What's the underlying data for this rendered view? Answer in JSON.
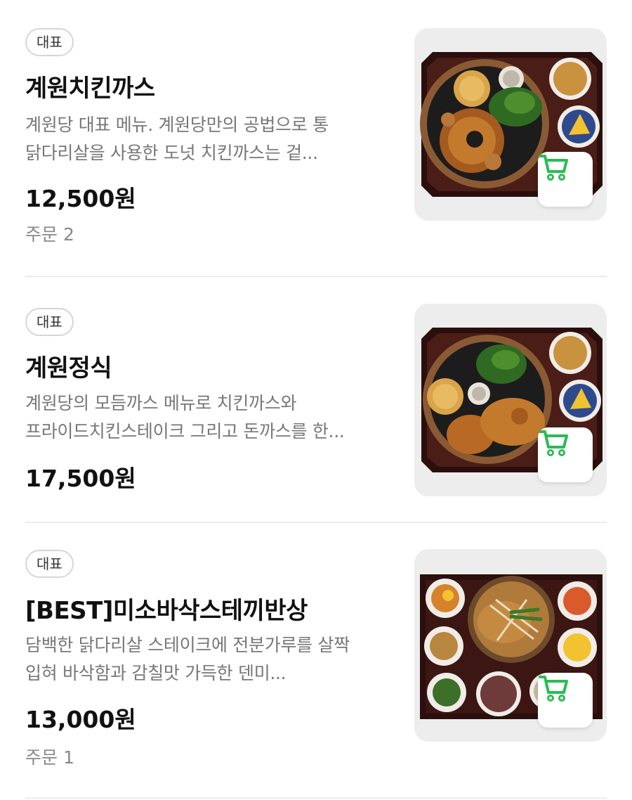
{
  "colors": {
    "cart_icon": "#2dbb54",
    "badge_border": "#d6d6d6",
    "desc_text": "#777777",
    "divider": "#ececec"
  },
  "items": [
    {
      "badge": "대표",
      "title": "계원치킨까스",
      "description": "계원당 대표 메뉴. 계원당만의 공법으로 통 닭다리살을 사용한 도넛 치킨까스는 겉...",
      "price": "12,500원",
      "orders": "주문 2",
      "cart_icon": "shopping-cart-icon"
    },
    {
      "badge": "대표",
      "title": "계원정식",
      "description": "계원당의 모듬까스 메뉴로 치킨까스와 프라이드치킨스테이크 그리고 돈까스를 한...",
      "price": "17,500원",
      "cart_icon": "shopping-cart-icon"
    },
    {
      "badge": "대표",
      "title": "[BEST]미소바삭스테끼반상",
      "description": "담백한 닭다리살 스테이크에 전분가루를 살짝 입혀 바삭함과 감칠맛 가득한 덴미...",
      "price": "13,000원",
      "orders": "주문 1",
      "cart_icon": "shopping-cart-icon"
    }
  ]
}
